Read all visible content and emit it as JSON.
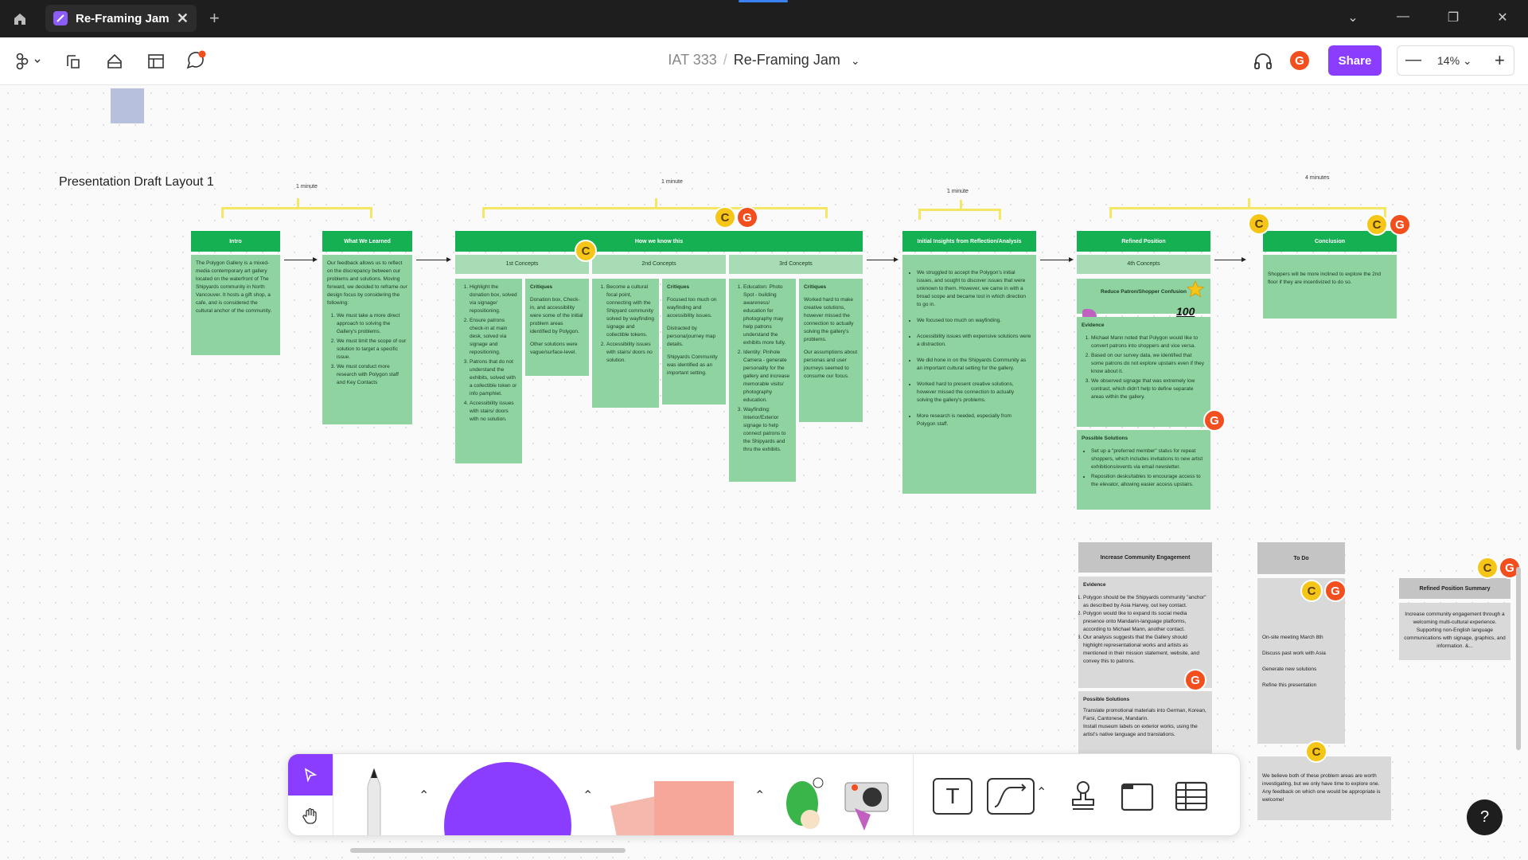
{
  "window": {
    "tab_title": "Re-Framing Jam",
    "tab_close": "✕",
    "new_tab": "+",
    "controls": [
      "⌄",
      "—",
      "❐",
      "✕"
    ]
  },
  "toolbar": {
    "project": "IAT 333",
    "separator": "/",
    "file_name": "Re-Framing Jam",
    "file_chevron": "⌄",
    "share_label": "Share",
    "zoom_value": "14%",
    "zoom_minus": "—",
    "zoom_plus": "+",
    "avatar_initial": "G"
  },
  "board": {
    "title": "Presentation Draft Layout 1",
    "durations": [
      "1 minute",
      "1 minute",
      "1 minute",
      "4 minutes"
    ],
    "sections": {
      "intro": {
        "head": "Intro",
        "body": "The Polygon Gallery is a mixed-media contemporary art gallery located on the waterfront of The Shipyards community in North Vancouver. It hosts a gift shop, a cafe, and is considered the cultural anchor of the community."
      },
      "learned": {
        "head": "What We Learned",
        "body": "Our feedback allows us to reflect on the discrepancy between our problems and solutions. Moving forward, we decided to reframe our design focus by considering the following:",
        "items": [
          "We must take a more direct approach to solving the Gallery's problems.",
          "We must limit the scope of our solution to target a specific issue.",
          "We must conduct more research with Polygon staff and Key Contacts"
        ]
      },
      "how": {
        "head": "How we know this",
        "concepts": [
          "1st Concepts",
          "2nd Concepts",
          "3rd Concepts"
        ],
        "c1_items": [
          "Highlight the donation box, solved via signage/ repositioning.",
          "Ensure patrons check-in at main desk, solved via signage and repositioning.",
          "Patrons that do not understand the exhibits, solved with a collectible token or info pamphlet.",
          "Accessibility issues with stairs/ doors with no solution."
        ],
        "c1_crit_title": "Critiques",
        "c1_crit": "Donation box, Check-in, and accessibility were some of the initial problem areas identified by Polygon.",
        "c1_crit2": "Other solutions were vague/surface-level.",
        "c2_items": [
          "Become a cultural focal point, connecting with the Shipyard community solved by wayfinding signage and collectible tokens.",
          "Accessibility issues with stairs/ doors no solution."
        ],
        "c2_crit_title": "Critiques",
        "c2_crit": "Focused too much on wayfinding and accessibility issues.",
        "c2_crit2": "Distracted by persona/journey map details.",
        "c2_crit3": "Shipyards Community was identified as an important setting.",
        "c3_items": [
          "Education: Photo Spot - building awareness/ education for photography may help patrons understand the exhibits more fully.",
          "Identity: Pinhole Camera - generate personality for the gallery and increase memorable visits/ photography education.",
          "Wayfinding: Interior/Exterior signage to help connect patrons to the Shipyards and thru the exhibits."
        ],
        "c3_crit_title": "Critiques",
        "c3_crit": "Worked hard to make creative solutions, however missed the connection to actually solving the gallery's problems.",
        "c3_crit2": "Our assumptions about personas and user journeys seemed to consume our focus."
      },
      "insights": {
        "head": "Initial Insights from Reflection/Analysis",
        "items": [
          "We struggled to accept the Polygon's initial issues, and sought to discover issues that were unknown to them. However, we came in with a broad scope and became lost in which direction to go in.",
          "We focused too much on wayfinding.",
          "Accessibility issues with expensive solutions were a distraction.",
          "We did hone in on the Shipyards Community as an important cultural setting for the gallery.",
          "Worked hard to present creative solutions, however missed the connection to actually solving the gallery's problems.",
          "More research is needed, especially from Polygon staff."
        ]
      },
      "refined": {
        "head": "Refined Position",
        "sub": "4th Concepts",
        "focus": "Reduce Patron/Shopper Confusion",
        "evidence_title": "Evidence",
        "evidence": [
          "Michael Mann noted that Polygon would like to convert patrons into shoppers and vice versa.",
          "Based on our survey data, we identified that some patrons do not explore upstairs even if they know about it.",
          "We observed signage that was extremely low contrast, which didn't help to define separate areas within the gallery."
        ],
        "solutions_title": "Possible Solutions",
        "solutions": [
          "Set up a \"preferred member\" status for repeat shoppers, which includes invitations to new artist exhibitions/events via email newsletter.",
          "Reposition desks/tables to encourage access to the elevator, allowing easier access upstairs."
        ]
      },
      "conclusion": {
        "head": "Conclusion",
        "body": "Shoppers will be more inclined to explore the 2nd floor if they are incentivized to do so."
      },
      "community": {
        "head": "Increase Community Engagement",
        "evidence_title": "Evidence",
        "evidence": [
          "Polygon should be the Shipyards community \"anchor\" as described by Asia Harvey, out key contact.",
          "Polygon would like to expand its social media presence onto Mandarin-language platforms, according to Michael Mann, another contact.",
          "Our analysis suggests that the Gallery should highlight representational works and artists as mentioned in their mission statement, website, and convey this to patrons."
        ],
        "solutions_title": "Possible Solutions",
        "solutions": [
          "Translate promotional materials into German, Korean, Farsi, Cantonese, Mandarin.",
          "Install museum labels on exterior works, using the artist's native language and translations."
        ]
      },
      "todo": {
        "head": "To Do",
        "items": [
          "On-site meeting March 8th",
          "Discuss past work with Asia",
          "Generate new solutions",
          "Refine this presentation"
        ],
        "footer": "We believe both of these problem areas are worth investigating, but we only have time to explore one. Any feedback on which one would be appropriate is welcome!"
      },
      "summary": {
        "head": "Refined Position Summary",
        "body": "Increase community engagement through a welcoming multi-cultural experience. Supporting non-English language communications with signage, graphics, and information. &..."
      }
    },
    "cursors": {
      "c": "C",
      "g": "G"
    },
    "badge_text": "100"
  },
  "help_label": "?",
  "colors": {
    "section_green": "#15b052",
    "note_green": "#8fd3a1",
    "bracket_yellow": "#f5e663",
    "share_purple": "#8b3dff",
    "avatar_red": "#f24e1e",
    "avatar_yellow": "#f5c518"
  }
}
